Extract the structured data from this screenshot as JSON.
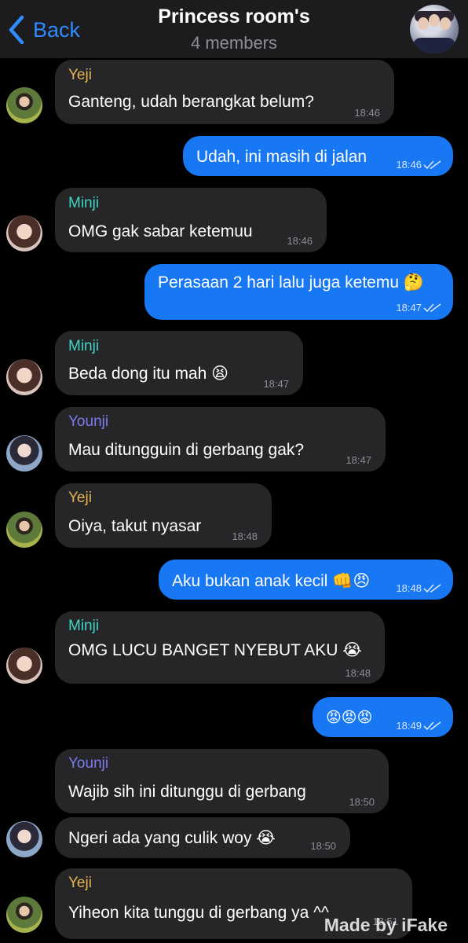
{
  "header": {
    "back_label": "Back",
    "title": "Princess room's",
    "subtitle": "4 members"
  },
  "colors": {
    "accent": "#2f8bff",
    "outgoing_bubble": "#1877f2",
    "incoming_bubble": "#262628",
    "background": "#000000"
  },
  "messages": [
    {
      "direction": "in",
      "sender": "Yeji",
      "sender_color": "#e5b552",
      "text": "Ganteng, udah berangkat belum?",
      "time": "18:46"
    },
    {
      "direction": "out",
      "text": "Udah, ini masih di jalan",
      "time": "18:46",
      "read": true
    },
    {
      "direction": "in",
      "sender": "Minji",
      "sender_color": "#3fd5c5",
      "text": "OMG gak sabar ketemuu",
      "time": "18:46"
    },
    {
      "direction": "out",
      "text": "Perasaan 2 hari lalu juga ketemu 🤔",
      "time": "18:47",
      "read": true
    },
    {
      "direction": "in",
      "sender": "Minji",
      "sender_color": "#3fd5c5",
      "text": "Beda dong itu mah 😫",
      "time": "18:47"
    },
    {
      "direction": "in",
      "sender": "Younji",
      "sender_color": "#7c7cf0",
      "text": "Mau ditungguin di gerbang gak?",
      "time": "18:47"
    },
    {
      "direction": "in",
      "sender": "Yeji",
      "sender_color": "#e5b552",
      "text": "Oiya, takut nyasar",
      "time": "18:48"
    },
    {
      "direction": "out",
      "text": "Aku bukan anak kecil 👊😠",
      "time": "18:48",
      "read": true
    },
    {
      "direction": "in",
      "sender": "Minji",
      "sender_color": "#3fd5c5",
      "text": "OMG LUCU BANGET NYEBUT AKU 😭",
      "time": "18:48"
    },
    {
      "direction": "out",
      "text": "😡😡😡",
      "time": "18:49",
      "read": true
    },
    {
      "direction": "in",
      "sender": "Younji",
      "sender_color": "#7c7cf0",
      "text": "Wajib sih ini ditunggu di gerbang",
      "time": "18:50"
    },
    {
      "direction": "in",
      "sender": "",
      "text": "Ngeri ada yang culik woy 😭",
      "time": "18:50"
    },
    {
      "direction": "in",
      "sender": "Yeji",
      "sender_color": "#e5b552",
      "text": "Yiheon kita tunggu di gerbang ya ^^",
      "time": "18:51"
    }
  ],
  "watermark": "Made by iFake"
}
